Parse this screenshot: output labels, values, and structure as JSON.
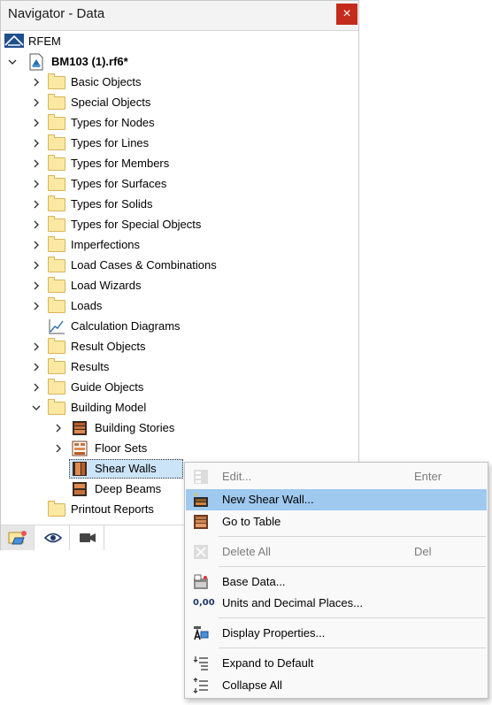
{
  "window": {
    "title": "Navigator - Data",
    "close_symbol": "×"
  },
  "tree": {
    "root_label": "RFEM",
    "file_label": "BM103 (1).rf6*",
    "items": [
      {
        "label": "Basic Objects"
      },
      {
        "label": "Special Objects"
      },
      {
        "label": "Types for Nodes"
      },
      {
        "label": "Types for Lines"
      },
      {
        "label": "Types for Members"
      },
      {
        "label": "Types for Surfaces"
      },
      {
        "label": "Types for Solids"
      },
      {
        "label": "Types for Special Objects"
      },
      {
        "label": "Imperfections"
      },
      {
        "label": "Load Cases & Combinations"
      },
      {
        "label": "Load Wizards"
      },
      {
        "label": "Loads"
      },
      {
        "label": "Calculation Diagrams"
      },
      {
        "label": "Result Objects"
      },
      {
        "label": "Results"
      },
      {
        "label": "Guide Objects"
      },
      {
        "label": "Building Model"
      },
      {
        "label": "Printout Reports"
      }
    ],
    "building_model_children": [
      {
        "label": "Building Stories"
      },
      {
        "label": "Floor Sets"
      },
      {
        "label": "Shear Walls"
      },
      {
        "label": "Deep Beams"
      }
    ]
  },
  "tabs": [
    {
      "icon": "data-tab-icon"
    },
    {
      "icon": "eye-icon"
    },
    {
      "icon": "camera-icon"
    }
  ],
  "context_menu": {
    "items": [
      {
        "label": "Edit...",
        "shortcut": "Enter",
        "disabled": true
      },
      {
        "label": "New Shear Wall...",
        "shortcut": "",
        "disabled": false,
        "highlighted": true
      },
      {
        "label": "Go to Table",
        "shortcut": "",
        "disabled": false
      },
      {
        "label": "Delete All",
        "shortcut": "Del",
        "disabled": true
      },
      {
        "label": "Base Data...",
        "shortcut": "",
        "disabled": false
      },
      {
        "label": "Units and Decimal Places...",
        "shortcut": "",
        "disabled": false
      },
      {
        "label": "Display Properties...",
        "shortcut": "",
        "disabled": false
      },
      {
        "label": "Expand to Default",
        "shortcut": "",
        "disabled": false
      },
      {
        "label": "Collapse All",
        "shortcut": "",
        "disabled": false
      }
    ],
    "units_icon_text": "0,00"
  },
  "colors": {
    "highlight": "#9fc9ee",
    "selection": "#cce4f7",
    "close_button": "#c42b1c",
    "folder": "#fbe8a2"
  }
}
